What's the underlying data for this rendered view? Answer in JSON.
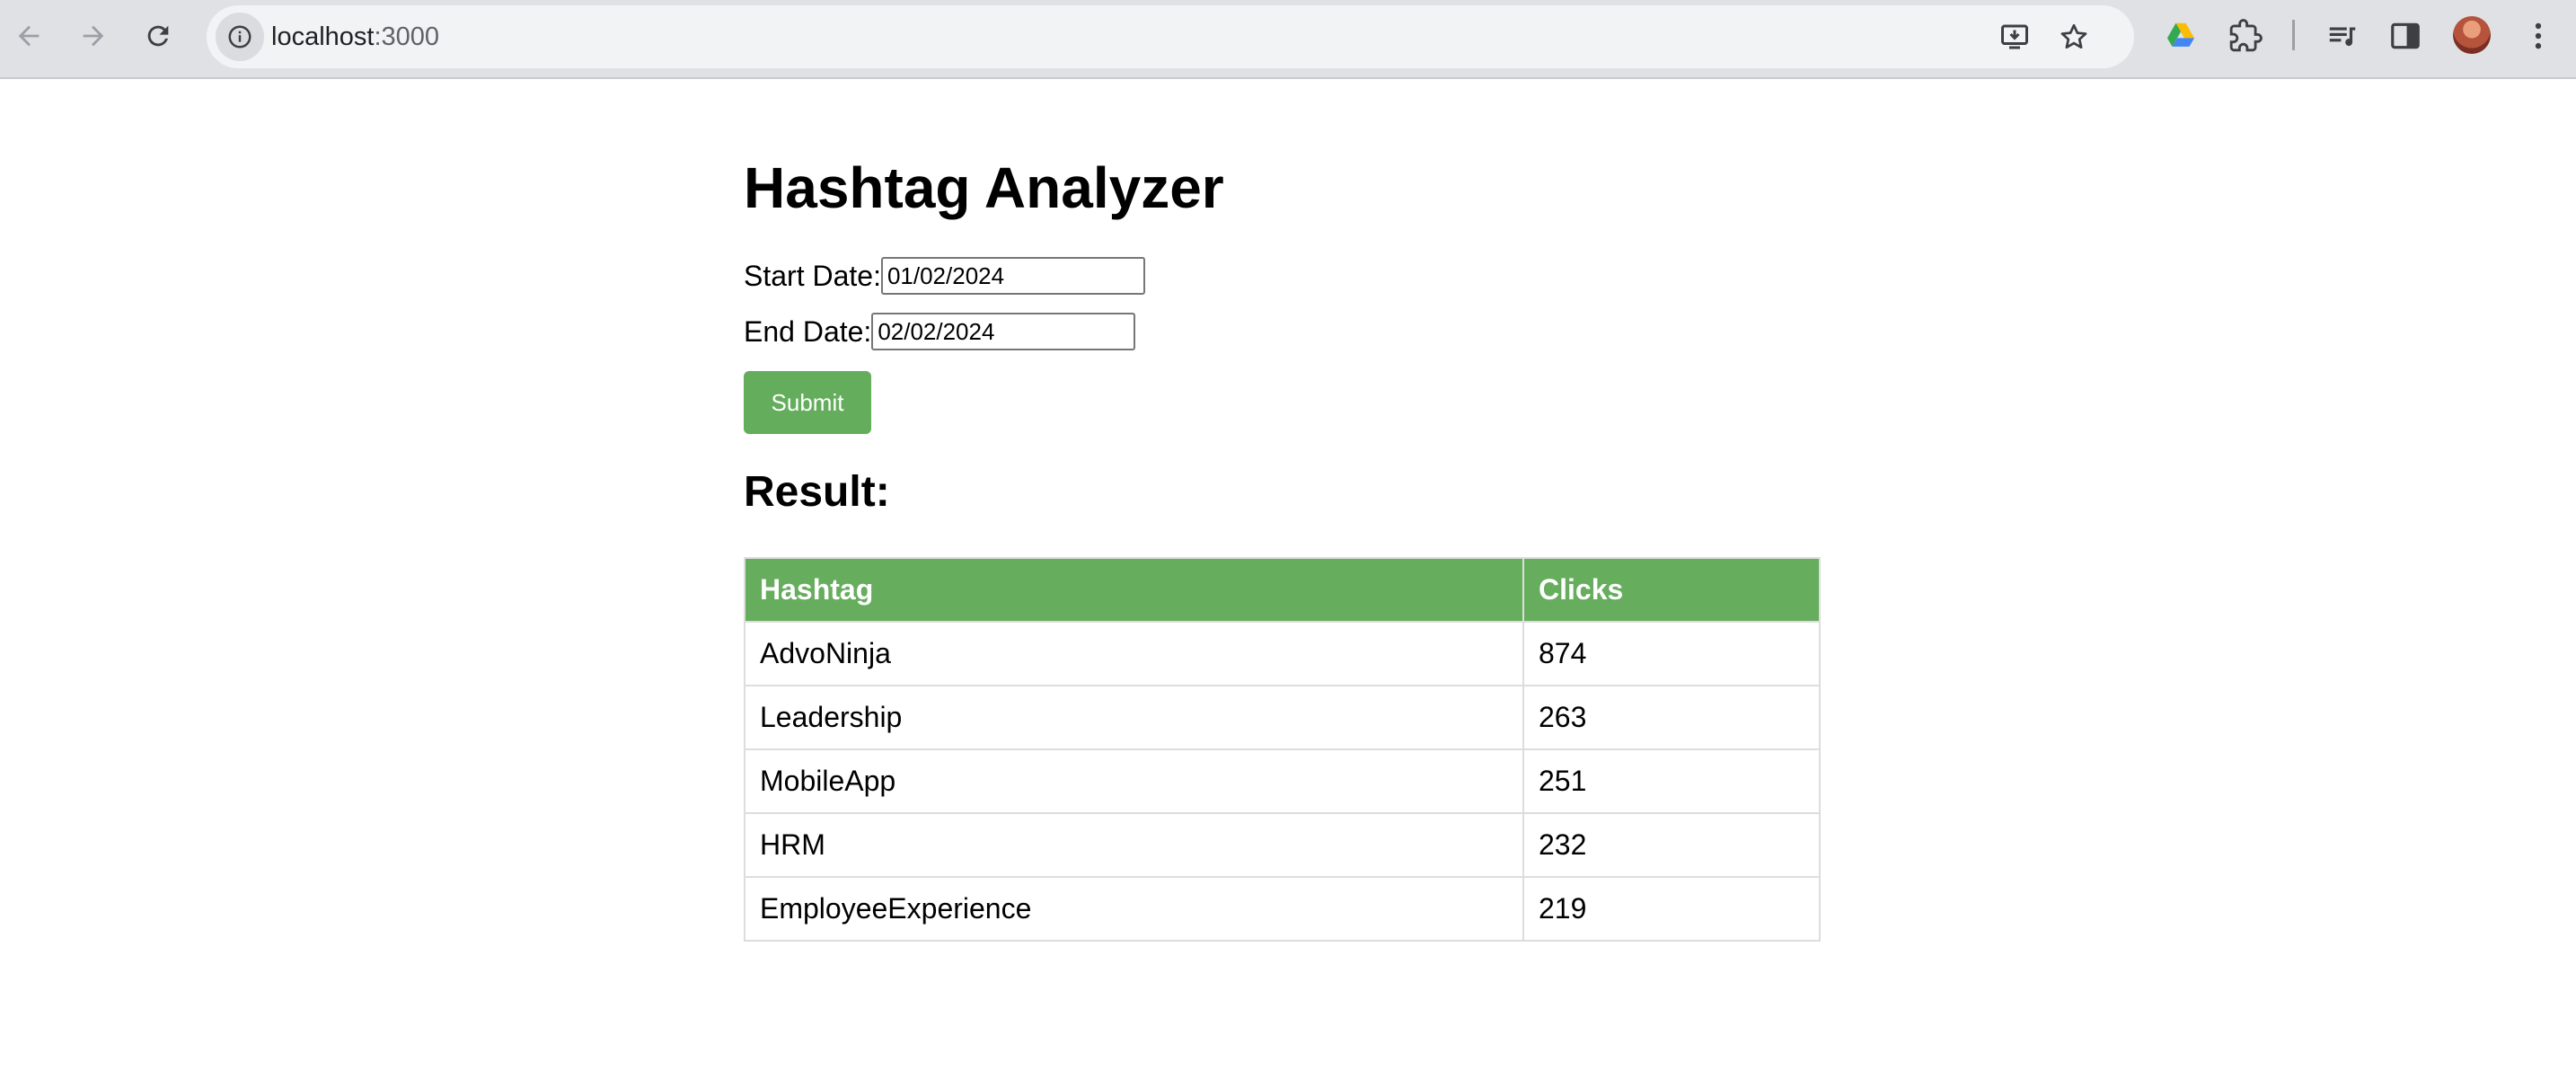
{
  "browser": {
    "url_host": "localhost",
    "url_port": ":3000",
    "icons": {
      "back": "arrow-left-icon",
      "forward": "arrow-right-icon",
      "reload": "reload-icon",
      "site_info": "info-icon",
      "install": "install-app-icon",
      "bookmark": "star-icon",
      "drive": "google-drive-icon",
      "extensions": "puzzle-icon",
      "media": "media-queue-icon",
      "side_panel": "side-panel-icon",
      "menu": "kebab-menu-icon"
    }
  },
  "app": {
    "title": "Hashtag Analyzer",
    "start_date_label": "Start Date:",
    "start_date_value": "01/02/2024",
    "end_date_label": "End Date:",
    "end_date_value": "02/02/2024",
    "submit_label": "Submit",
    "result_heading": "Result:",
    "accent_color": "#66ad5e"
  },
  "table": {
    "headers": [
      "Hashtag",
      "Clicks"
    ],
    "rows": [
      [
        "AdvoNinja",
        "874"
      ],
      [
        "Leadership",
        "263"
      ],
      [
        "MobileApp",
        "251"
      ],
      [
        "HRM",
        "232"
      ],
      [
        "EmployeeExperience",
        "219"
      ]
    ]
  }
}
